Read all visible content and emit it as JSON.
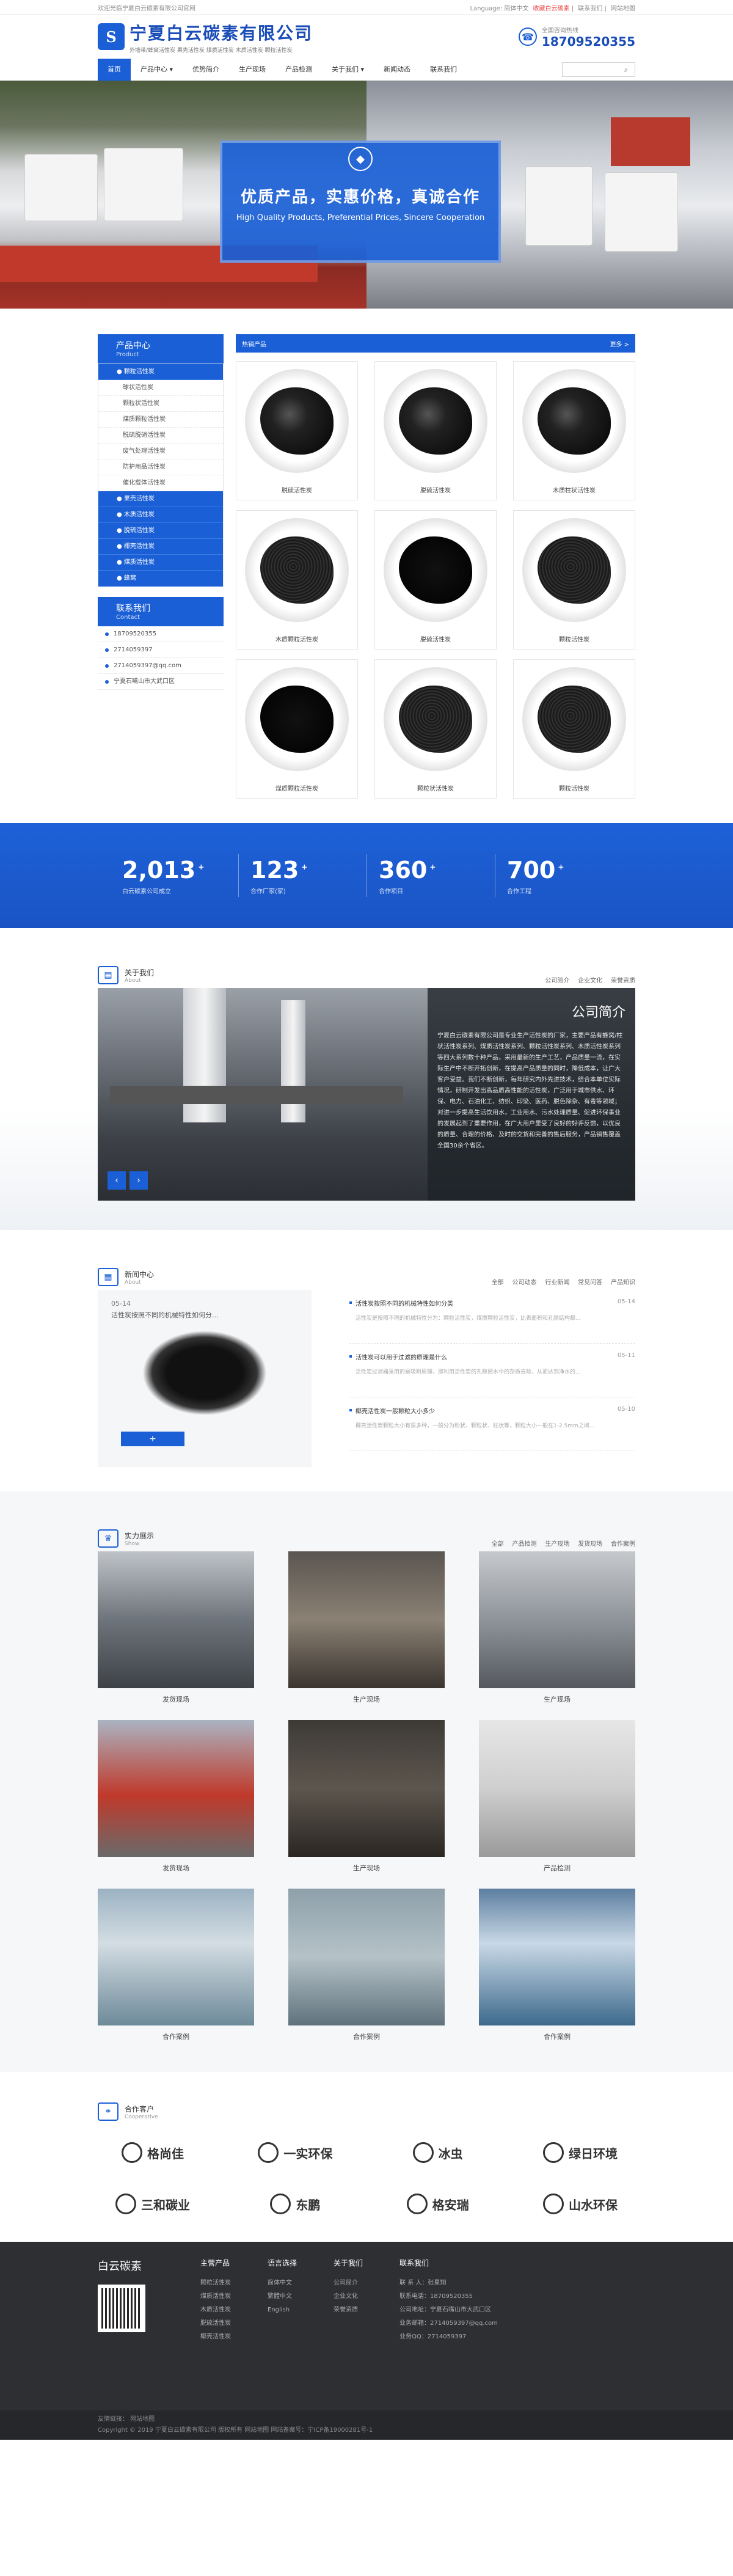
{
  "topbar": {
    "welcome": "欢迎光临宁夏白云碳素有限公司官网",
    "language": "Language: 简体中文",
    "links": [
      "收藏白云碳素",
      "联系我们",
      "网站地图"
    ]
  },
  "header": {
    "logo_mark": "S",
    "logo_title": "宁夏白云碳素有限公司",
    "logo_sub": "外墙带/蜂窝活性炭 果壳活性炭 煤质活性炭 木质活性炭 颗粒活性炭",
    "hotline_label": "全国咨询热线",
    "hotline": "18709520355"
  },
  "nav": {
    "items": [
      "首页",
      "产品中心",
      "优势简介",
      "生产现场",
      "产品检测",
      "关于我们",
      "新闻动态",
      "联系我们"
    ],
    "search_placeholder": ""
  },
  "banner": {
    "title": "优质产品，实惠价格，真诚合作",
    "subtitle": "High Quality Products, Preferential Prices, Sincere Cooperation"
  },
  "sidebar": {
    "title": "产品中心",
    "subtitle": "Product",
    "categories": [
      {
        "label": "● 颗粒活性炭",
        "subs": [
          "球状活性炭",
          "颗粒状活性炭",
          "煤质颗粒活性炭",
          "脱硫脱硝活性炭",
          "废气处理活性炭",
          "防护用品活性炭",
          "催化载体活性炭"
        ]
      },
      {
        "label": "● 果壳活性炭",
        "subs": []
      },
      {
        "label": "● 木质活性炭",
        "subs": []
      },
      {
        "label": "● 脱硫活性炭",
        "subs": []
      },
      {
        "label": "● 椰壳活性炭",
        "subs": []
      },
      {
        "label": "● 煤质活性炭",
        "subs": []
      },
      {
        "label": "● 蜂窝",
        "subs": []
      }
    ],
    "contact_title": "联系我们",
    "contact_subtitle": "Contact",
    "contact": [
      "18709520355",
      "2714059397",
      "2714059397@qq.com",
      "宁夏石嘴山市大武口区"
    ]
  },
  "products": {
    "head": "热销产品",
    "more": "更多 >",
    "items": [
      {
        "name": "脱硫活性炭",
        "kind": "pellet"
      },
      {
        "name": "脱硫活性炭",
        "kind": "pellet"
      },
      {
        "name": "木质柱状活性炭",
        "kind": "pellet"
      },
      {
        "name": "木质颗粒活性炭",
        "kind": "granule"
      },
      {
        "name": "脱硫活性炭",
        "kind": "powder"
      },
      {
        "name": "颗粒活性炭",
        "kind": "granule"
      },
      {
        "name": "煤质颗粒活性炭",
        "kind": "powder"
      },
      {
        "name": "颗粒状活性炭",
        "kind": "granule"
      },
      {
        "name": "颗粒活性炭",
        "kind": "granule"
      }
    ]
  },
  "stats": [
    {
      "num": "2,013",
      "sup": "+",
      "label": "白云碳素公司成立"
    },
    {
      "num": "123",
      "sup": "+",
      "label": "合作厂家(家)"
    },
    {
      "num": "360",
      "sup": "+",
      "label": "合作项目"
    },
    {
      "num": "700",
      "sup": "+",
      "label": "合作工程"
    }
  ],
  "about": {
    "title": "关于我们",
    "subtitle": "About",
    "tabs": [
      "公司简介",
      "企业文化",
      "荣誉资质"
    ],
    "box_title": "公司简介",
    "text": "宁夏白云碳素有限公司是专业生产活性炭的厂家，主要产品有蜂窝/柱状活性炭系列、煤质活性炭系列、颗粒活性炭系列、木质活性炭系列等四大系列数十种产品，采用最新的生产工艺，产品质量一流，在实际生产中不断开拓创新，在提高产品质量的同时，降低成本，让广大客户受益。我们不断创新，每年研究内外先进技术，结合本单位实际情况，研制开发出高品质高性能的活性炭，广泛用于城市供水、环保、电力、石油化工、纺织、印染、医药、脱色除杂、有毒等领域；对进一步提高生活饮用水，工业用水、污水处理质量、促进环保事业的发展起到了重要作用，在广大用户里受了良好的好评反馈，以优良的质量、合理的价格、及时的交货和完善的售后服务，产品销售覆盖全国30余个省区。"
  },
  "news": {
    "title": "新闻中心",
    "subtitle": "About",
    "tabs": [
      "全部",
      "公司动态",
      "行业新闻",
      "常见问答",
      "产品知识"
    ],
    "featured": {
      "date": "05-14",
      "title": "活性炭按照不同的机械特性如何分..."
    },
    "more": "+",
    "items": [
      {
        "title": "活性炭按照不同的机械特性如何分类",
        "date": "05-14",
        "excerpt": "活性炭是按照不同的机械特性分为：颗粒活性炭，煤质颗粒活性炭，比表面积和孔隙结构都..."
      },
      {
        "title": "活性炭可以用于过滤的原理是什么",
        "date": "05-11",
        "excerpt": "活性炭过滤器采用的是吸附原理，即利用活性炭的孔隙把水中的杂质去除，从而达到净水的..."
      },
      {
        "title": "椰壳活性炭一般颗粒大小多少",
        "date": "05-10",
        "excerpt": "椰壳活性炭颗粒大小有很多种，一般分为粉状、颗粒状、柱状等，颗粒大小一般在1-2.5mm之间..."
      }
    ]
  },
  "strength": {
    "title": "实力展示",
    "subtitle": "Show",
    "tabs": [
      "全部",
      "产品检测",
      "生产现场",
      "发货现场",
      "合作案例"
    ],
    "items": [
      "发货现场",
      "生产现场",
      "生产现场",
      "发货现场",
      "生产现场",
      "产品检测",
      "合作案例",
      "合作案例",
      "合作案例"
    ]
  },
  "partners": {
    "title": "合作客户",
    "subtitle": "Cooperative",
    "items": [
      "格尚佳",
      "一实环保",
      "冰虫",
      "绿日环境",
      "三和碳业",
      "东鹏",
      "格安瑞",
      "山水环保"
    ]
  },
  "footer": {
    "brand": "白云碳素",
    "cols": [
      {
        "title": "主营产品",
        "items": [
          "颗粒活性炭",
          "煤质活性炭",
          "木质活性炭",
          "脱硫活性炭",
          "椰壳活性炭"
        ]
      },
      {
        "title": "语言选择",
        "items": [
          "简体中文",
          "繁體中文",
          "English"
        ]
      },
      {
        "title": "关于我们",
        "items": [
          "公司简介",
          "企业文化",
          "荣誉资质"
        ]
      },
      {
        "title": "联系我们",
        "items": [
          "联 系 人：张星翔",
          "联系电话：18709520355",
          "公司地址：宁夏石嘴山市大武口区",
          "业务邮箱：2714059397@qq.com",
          "业务QQ：2714059397"
        ]
      }
    ],
    "bottom_links": "友情链接：  网站地图",
    "copyright": "Copyright © 2019 宁夏白云碳素有限公司 版权所有  网站地图  网站备案号：宁ICP备19000281号-1"
  }
}
